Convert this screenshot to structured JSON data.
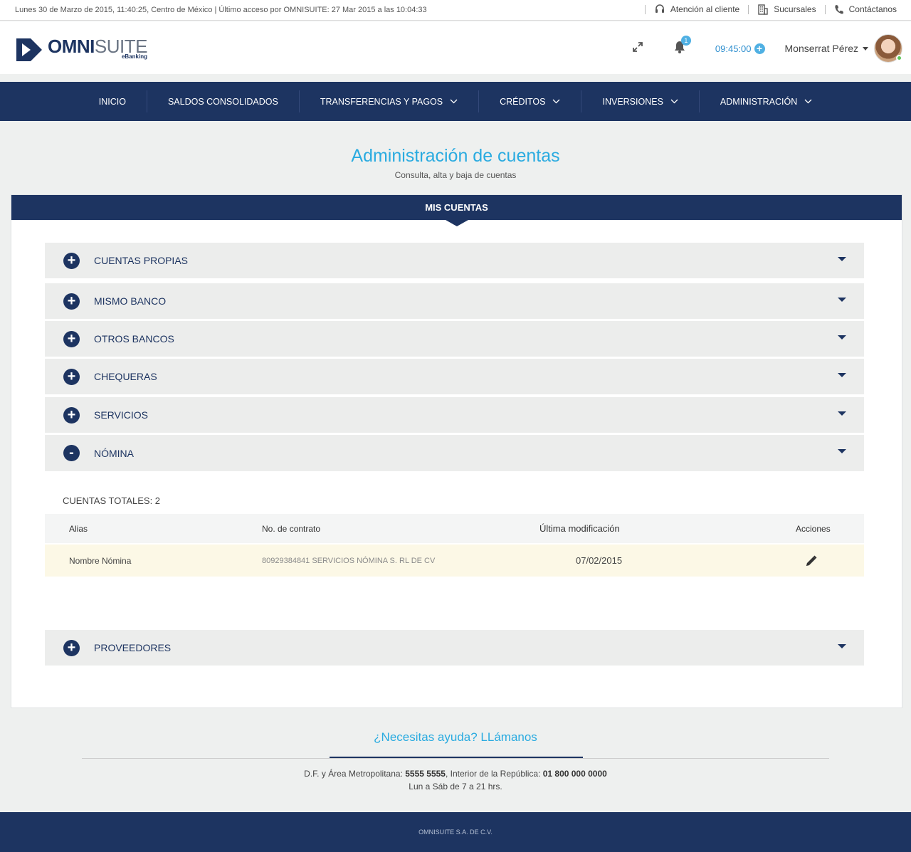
{
  "topbar": {
    "session_info": "Lunes 30 de Marzo de 2015, 11:40:25,  Centro de México | Último acceso por OMNISUITE: 27 Mar 2015 a las 10:04:33",
    "links": [
      {
        "label": "Atención al cliente",
        "icon": "headset-icon"
      },
      {
        "label": "Sucursales",
        "icon": "building-icon"
      },
      {
        "label": "Contáctanos",
        "icon": "phone-icon"
      }
    ]
  },
  "header": {
    "logo_bold": "OMNI",
    "logo_light": "SUITE",
    "logo_sub": "eBanking",
    "notifications": "1",
    "session_timer": "09:45:00",
    "user_name": "Monserrat Pérez"
  },
  "nav": {
    "items": [
      {
        "label": "INICIO",
        "has_dropdown": false
      },
      {
        "label": "SALDOS CONSOLIDADOS",
        "has_dropdown": false
      },
      {
        "label": "TRANSFERENCIAS Y PAGOS",
        "has_dropdown": true
      },
      {
        "label": "CRÉDITOS",
        "has_dropdown": true
      },
      {
        "label": "INVERSIONES",
        "has_dropdown": true
      },
      {
        "label": "ADMINISTRACIÓN",
        "has_dropdown": true
      }
    ]
  },
  "page": {
    "title": "Administración de cuentas",
    "subtitle": "Consulta, alta y baja de cuentas"
  },
  "panel": {
    "header": "MIS CUENTAS",
    "sections": [
      {
        "label": "CUENTAS PROPIAS",
        "toggle": "+"
      },
      {
        "label": "MISMO BANCO",
        "toggle": "+"
      },
      {
        "label": "OTROS BANCOS",
        "toggle": "+"
      },
      {
        "label": "CHEQUERAS",
        "toggle": "+"
      },
      {
        "label": "SERVICIOS",
        "toggle": "+"
      },
      {
        "label": "NÓMINA",
        "toggle": "-"
      },
      {
        "label": "PROVEEDORES",
        "toggle": "+"
      }
    ],
    "totals": "CUENTAS TOTALES: 2",
    "table": {
      "columns": [
        "Alias",
        "No. de contrato",
        "Última modificación",
        "Acciones"
      ],
      "rows": [
        {
          "alias": "Nombre Nómina",
          "contract": "80929384841 SERVICIOS NÓMINA S. RL  DE CV",
          "modified": "07/02/2015",
          "action_icon": "pencil-icon"
        }
      ]
    }
  },
  "help": {
    "title": "¿Necesitas ayuda? LLámanos",
    "line1_a": "D.F. y Área Metropolitana: ",
    "line1_b": "5555 5555",
    "line1_c": ", Interior de la República: ",
    "line1_d": "01 800 000 0000",
    "line2": "Lun a Sáb de 7 a 21 hrs."
  },
  "footer": {
    "text": "OMNISUITE S.A. DE C.V."
  },
  "colors": {
    "navy": "#1d3461",
    "accent_blue": "#2aabe0",
    "row_highlight": "#fcf8e6"
  }
}
